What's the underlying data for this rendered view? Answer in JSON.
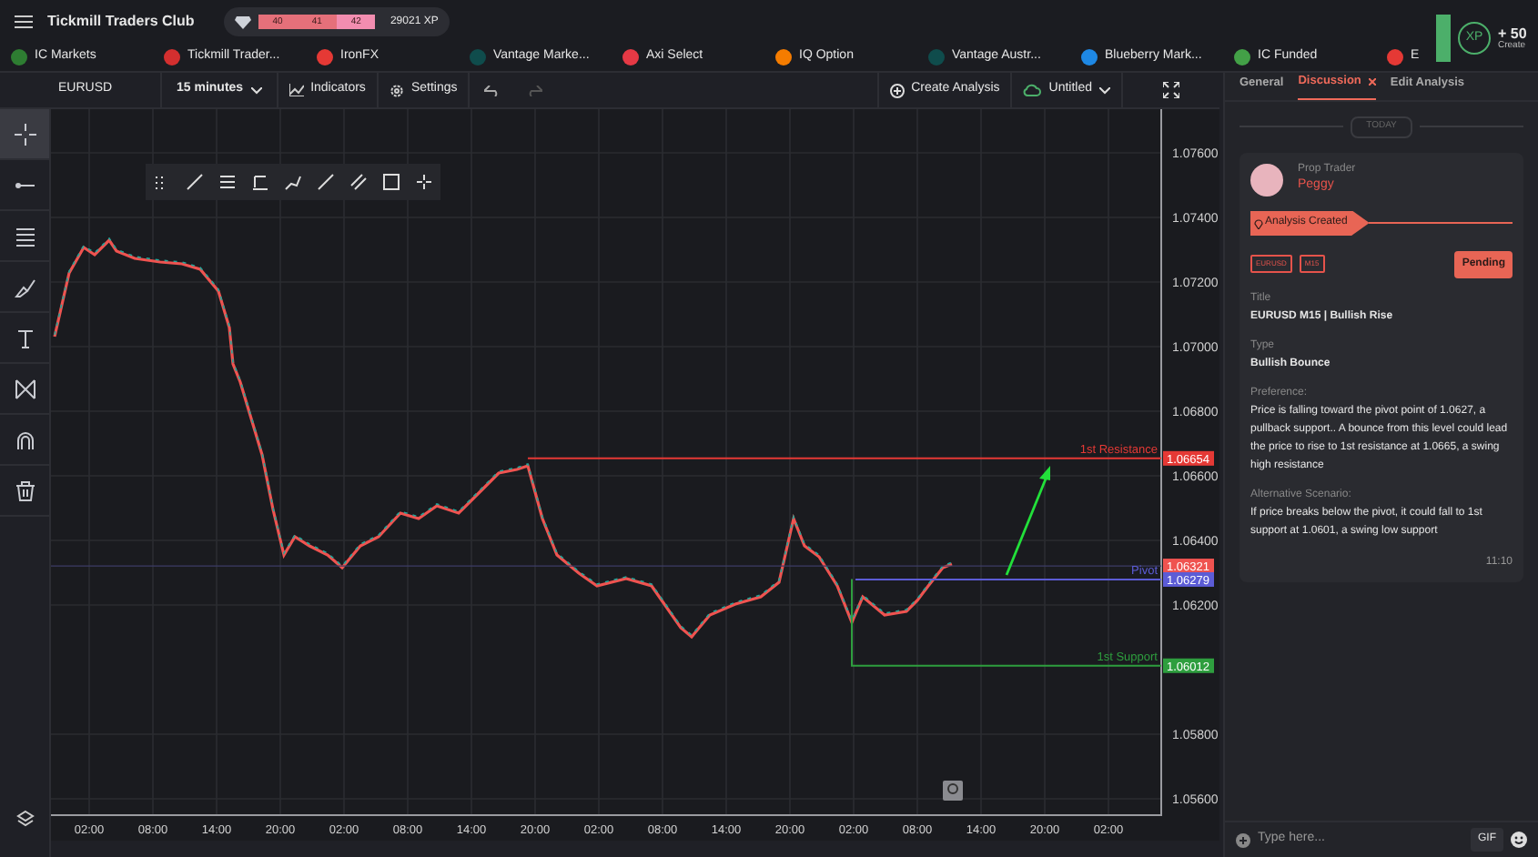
{
  "app_title": "Tickmill Traders Club",
  "xp": {
    "badges": [
      "40",
      "41",
      "42"
    ],
    "total": "29021 XP"
  },
  "xp_widget": {
    "label": "XP",
    "value": "+ 50",
    "caption": "Create"
  },
  "brokers": [
    {
      "name": "IC Markets",
      "color": "#2e7d32"
    },
    {
      "name": "Tickmill Trader...",
      "color": "#d32f2f"
    },
    {
      "name": "IronFX",
      "color": "#e53935"
    },
    {
      "name": "Vantage Marke...",
      "color": "#0f4c4c"
    },
    {
      "name": "Axi Select",
      "color": "#e53945"
    },
    {
      "name": "IQ Option",
      "color": "#f57c00"
    },
    {
      "name": "Vantage Austr...",
      "color": "#0f4c4c"
    },
    {
      "name": "Blueberry Mark...",
      "color": "#1e88e5"
    },
    {
      "name": "IC Funded",
      "color": "#43a047"
    },
    {
      "name": "E",
      "color": "#e53935"
    }
  ],
  "toolbar": {
    "symbol": "EURUSD",
    "interval": "15 minutes",
    "indicators": "Indicators",
    "settings": "Settings",
    "create": "Create Analysis",
    "layout": "Untitled"
  },
  "tools": [
    {
      "kind": "crosshair",
      "selected": true
    },
    {
      "kind": "line",
      "selected": false
    },
    {
      "kind": "lines",
      "selected": false
    },
    {
      "kind": "brush",
      "selected": false
    },
    {
      "kind": "text",
      "selected": false
    },
    {
      "kind": "pattern",
      "selected": false
    },
    {
      "kind": "magnet",
      "selected": false
    },
    {
      "kind": "trash",
      "selected": false
    }
  ],
  "chart": {
    "price_ticks": [
      "1.07600",
      "1.07400",
      "1.07200",
      "1.07000",
      "1.06800",
      "1.06600",
      "1.06400",
      "1.06200",
      "1.05800",
      "1.05600"
    ],
    "time_ticks": [
      "02:00",
      "08:00",
      "14:00",
      "20:00",
      "02:00",
      "08:00",
      "14:00",
      "20:00",
      "02:00",
      "08:00",
      "14:00",
      "20:00",
      "02:00",
      "08:00",
      "14:00",
      "20:00",
      "02:00"
    ],
    "current_price": "1.06321",
    "levels": [
      {
        "kind": "resistance",
        "label": "1st Resistance",
        "tag": "1.06654",
        "color": "#e53935"
      },
      {
        "kind": "pivot",
        "label": "Pivot",
        "tag": "1.06279",
        "color": "#5c5cd6"
      },
      {
        "kind": "support",
        "label": "1st Support",
        "tag": "1.06012",
        "color": "#2e9e3e"
      }
    ]
  },
  "panel": {
    "tabs": [
      {
        "label": "General",
        "selected": false
      },
      {
        "label": "Discussion",
        "selected": true
      },
      {
        "label": "Edit Analysis",
        "selected": false
      }
    ],
    "day": "TODAY",
    "message": {
      "role": "Prop Trader",
      "author": "Peggy",
      "event": "Analysis Created",
      "tags": [
        "EURUSD",
        "M15"
      ],
      "status": "Pending",
      "fields": [
        {
          "label": "Title",
          "value": "EURUSD M15 | Bullish Rise",
          "bold": true
        },
        {
          "label": "Type",
          "value": "Bullish Bounce",
          "bold": true
        },
        {
          "label": "Preference:",
          "value": "Price is falling toward the pivot point of 1.0627, a pullback support.. A bounce from this level could lead the price to rise to 1st resistance at 1.0665, a swing high resistance",
          "bold": false
        },
        {
          "label": "Alternative Scenario:",
          "value": "If price breaks below the pivot, it could fall to 1st support at 1.0601, a swing low support",
          "bold": false
        }
      ],
      "time": "11:10"
    },
    "composer": {
      "placeholder": "Type here...",
      "gif": "GIF"
    }
  }
}
